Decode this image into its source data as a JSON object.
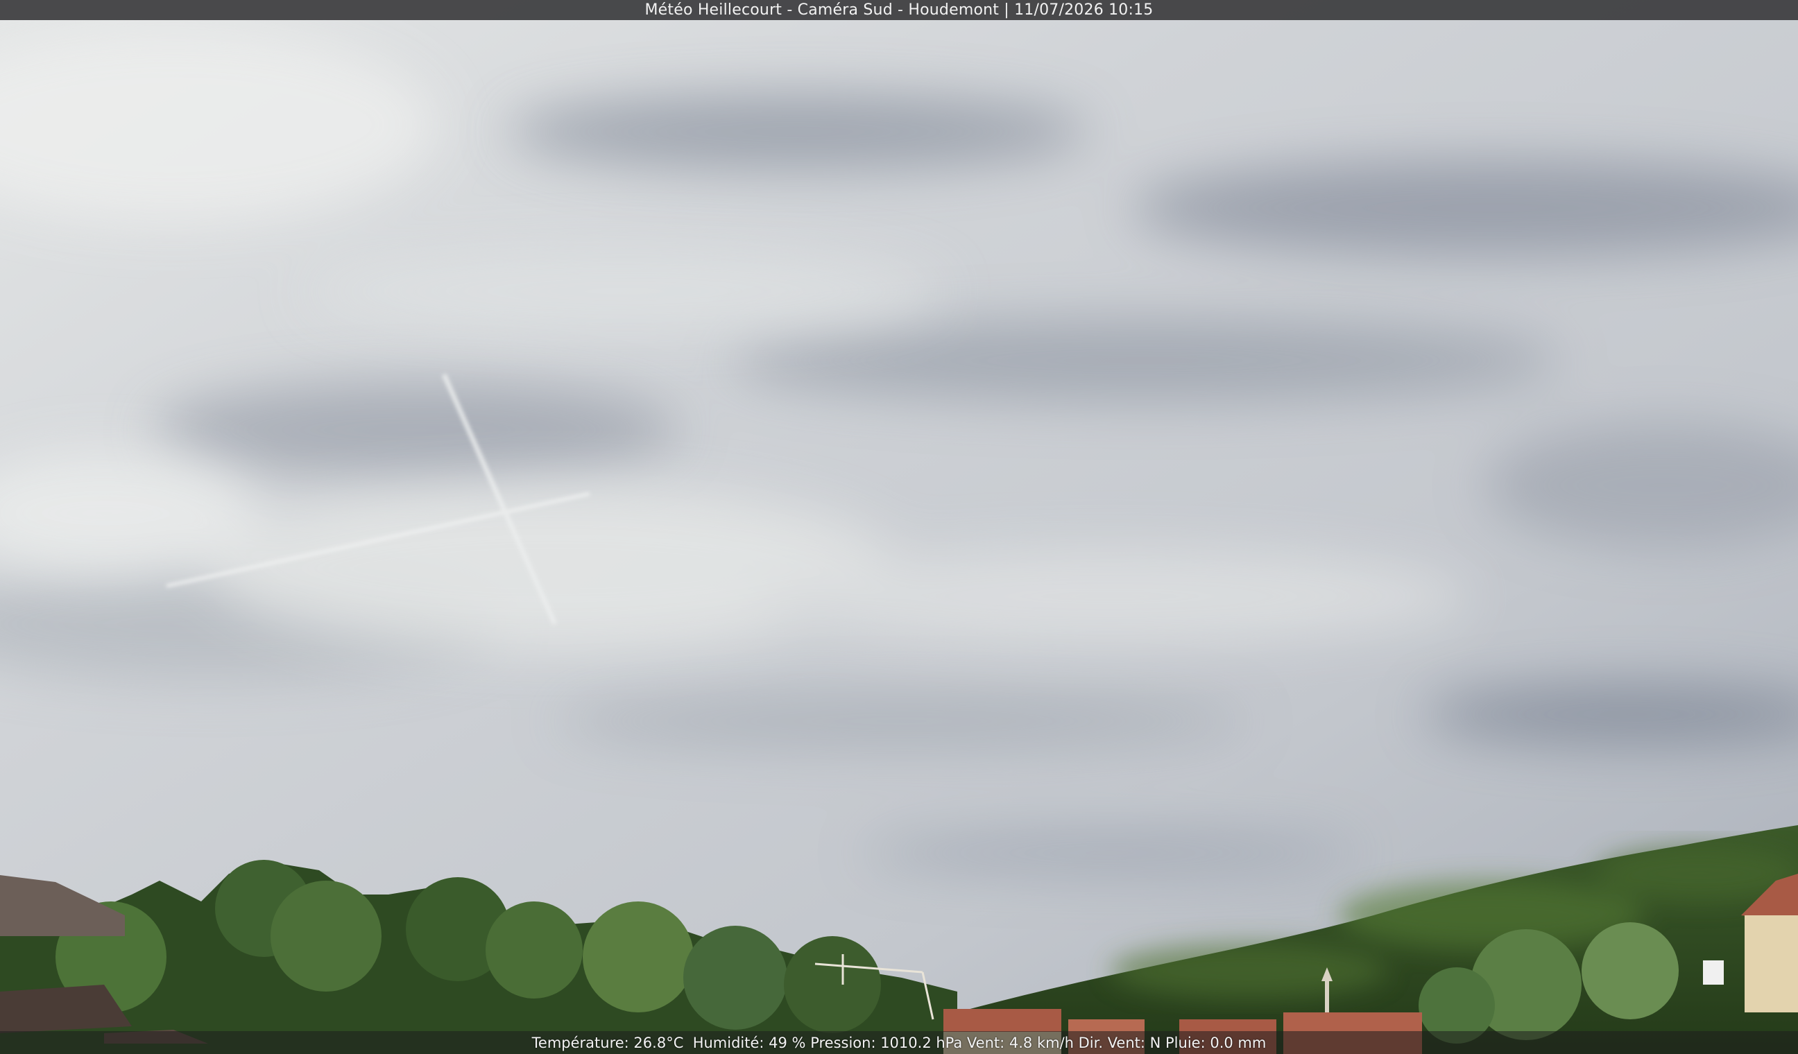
{
  "overlay": {
    "title": "Météo Heillecourt - Caméra Sud - Houdemont | 11/07/2026 10:15",
    "weather_line": "Température: 26.8°C  Humidité: 49 % Pression: 1010.2 hPa Vent: 4.8 km/h Dir. Vent: N Pluie: 0.0 mm"
  },
  "colors": {
    "sky_light": "#dcdedf",
    "sky_mid": "#b9bdc4",
    "sky_dark": "#8f96a3",
    "foliage_dark": "#2f4a22",
    "foliage_light": "#5d7f3a",
    "roof": "#a85a45",
    "wall": "#e3d3ae"
  }
}
